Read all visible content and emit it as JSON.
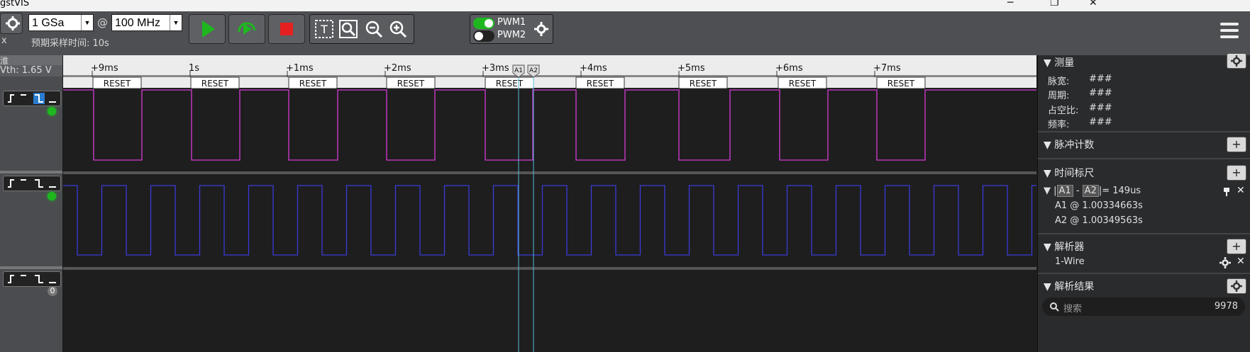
{
  "app": {
    "title": "gstVIS"
  },
  "toolbar": {
    "sample_rate": "1 GSa",
    "at": "@",
    "frequency": "100 MHz",
    "estimated_label": "预期采样时间: 10s",
    "pwm1": "PWM1",
    "pwm2": "PWM2",
    "left_label": "x"
  },
  "left_pane": {
    "header": "淮",
    "vth": "Vth: 1.65 V",
    "ch3_count": "0"
  },
  "timeline": {
    "ticks": [
      "+9ms",
      "1s",
      "+1ms",
      "+2ms",
      "+3ms",
      "+4ms",
      "+5ms",
      "+6ms",
      "+7ms"
    ],
    "cursor_a1": "A1",
    "cursor_a2": "A2"
  },
  "decode": {
    "label": "RESET",
    "count": 9
  },
  "panel": {
    "measure": {
      "title": "测量",
      "rows": [
        {
          "k": "脉宽:",
          "v": "###"
        },
        {
          "k": "周期:",
          "v": "###"
        },
        {
          "k": "占空比:",
          "v": "###"
        },
        {
          "k": "频率:",
          "v": "###"
        }
      ]
    },
    "pulse_count": {
      "title": "脉冲计数"
    },
    "time_ruler": {
      "title": "时间标尺",
      "a1": "A1",
      "dash": "-",
      "a2": "A2",
      "eq": "= 149us",
      "line1": "A1 @ 1.00334663s",
      "line2": "A2 @ 1.00349563s"
    },
    "decoder": {
      "title": "解析器",
      "item": "1-Wire"
    },
    "results": {
      "title": "解析结果",
      "search_placeholder": "搜索",
      "count": "9978"
    }
  },
  "colors": {
    "ch1": "#d63ad6",
    "ch2": "#3b3bd9",
    "cursor": "#5ab8e0",
    "accent_green": "#1eb81e",
    "stop_red": "#e62020"
  }
}
